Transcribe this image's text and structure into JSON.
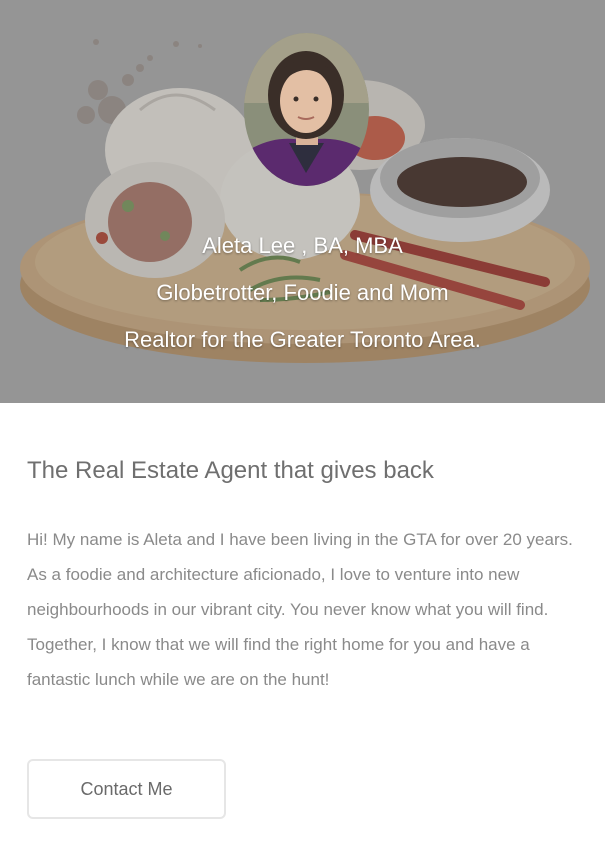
{
  "hero": {
    "name_line": "Aleta Lee , BA, MBA",
    "tagline": "Globetrotter, Foodie and Mom",
    "role_line": "Realtor for the Greater Toronto Area."
  },
  "main": {
    "heading": "The Real Estate Agent that gives back",
    "body": "Hi! My name is Aleta and I have been living in the GTA for over 20 years. As a foodie and architecture aficionado, I love to venture into new neighbourhoods in our vibrant city. You never know what you will find. Together, I know that we will find the right home for you and have a fantastic lunch while we are on the hunt!",
    "contact_label": "Contact Me"
  },
  "colors": {
    "hero_bg": "#9c9c9c",
    "heading": "#6f6f6f",
    "body_text": "#8a8a8a",
    "button_border": "#e6e6e6"
  },
  "icons": [
    "dumpling-illustration",
    "profile-photo"
  ]
}
